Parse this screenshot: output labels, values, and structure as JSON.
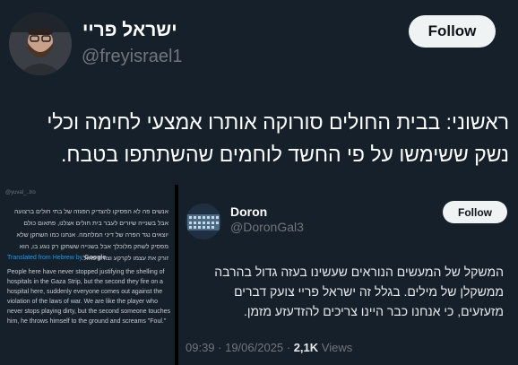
{
  "main_tweet": {
    "author_name": "ישראל פריי",
    "handle": "@freyisrael1",
    "follow_label": "Follow",
    "text": "ראשוני: בבית החולים סורוקה אותרו אמצעי לחימה וכלי נשק ששימשו על פי החשד לוחמים שהשתתפו בטבח."
  },
  "quoted_left": {
    "handle": "@yuval_..tro",
    "hebrew_text": "אנשים פה לא הפסיקו להצדיק הפגזה של בתי חולים ברצועה אבל בשנייה שיורים לעבר בית חולים אצלנו, פתאום כולם יוצאים נגד הפרה של דיני המלחמה. אנחנו כמו השחקן שלא מפסיק לשחק מלוכלך אבל בשנייה ששחקן רק נוגע בו, הוא זורק את עצמו לקרקע וצורח פאול.",
    "translated_label": "Translated from Hebrew by",
    "translator": "Google",
    "english_text": "People here have never stopped justifying the shelling of hospitals in the Gaza Strip, but the second they fire on a hospital here, suddenly everyone comes out against the violation of the laws of war. We are like the player who never stops playing dirty, but the second someone touches him, he throws himself to the ground and screams \"Foul.\""
  },
  "reply_tweet": {
    "author_name": "Doron",
    "handle": "@DoronGal3",
    "follow_label": "Follow",
    "text": "המשקל של המעשים הנוראים שעשינו בעזה גדול בהרבה ממשקלן של מילים. בגלל זה ישראל פריי צועק דברים מזעזעים, כי אנחנו כבר היינו צריכים להזדעזע מזמן.",
    "timestamp": "09:39 · 19/06/2025 · ",
    "views_count": "2,1K",
    "views_label": " Views"
  }
}
